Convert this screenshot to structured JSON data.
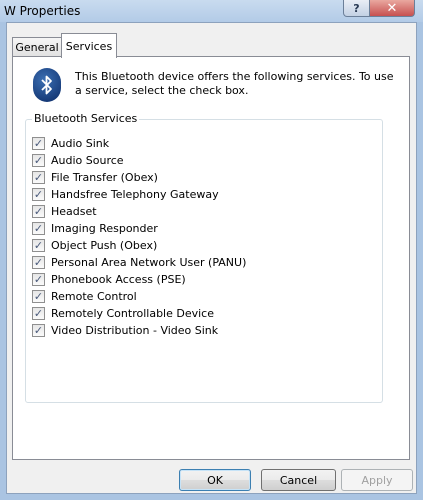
{
  "window": {
    "title": "W Properties",
    "help_label": "?",
    "close_label": "✕"
  },
  "tabs": [
    {
      "label": "General",
      "selected": false
    },
    {
      "label": "Services",
      "selected": true
    }
  ],
  "services_tab": {
    "icon": "bluetooth-icon",
    "intro_text": "This Bluetooth device offers the following services. To use a service, select the check box.",
    "group_title": "Bluetooth Services",
    "services": [
      {
        "label": "Audio Sink",
        "checked": true
      },
      {
        "label": "Audio Source",
        "checked": true
      },
      {
        "label": "File Transfer (Obex)",
        "checked": true
      },
      {
        "label": "Handsfree Telephony Gateway",
        "checked": true
      },
      {
        "label": "Headset",
        "checked": true
      },
      {
        "label": "Imaging Responder",
        "checked": true
      },
      {
        "label": "Object Push (Obex)",
        "checked": true
      },
      {
        "label": "Personal Area Network User (PANU)",
        "checked": true
      },
      {
        "label": "Phonebook Access (PSE)",
        "checked": true
      },
      {
        "label": "Remote Control",
        "checked": true
      },
      {
        "label": "Remotely Controllable Device",
        "checked": true
      },
      {
        "label": "Video Distribution - Video Sink",
        "checked": true
      }
    ]
  },
  "buttons": {
    "ok": "OK",
    "cancel": "Cancel",
    "apply": "Apply"
  }
}
